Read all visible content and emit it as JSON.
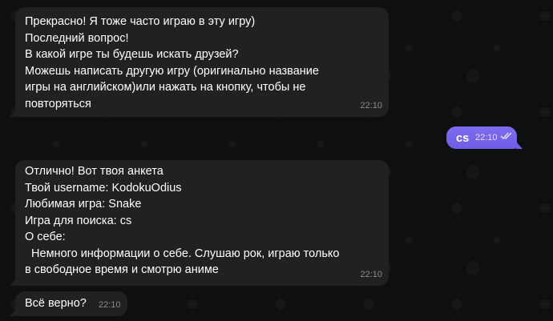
{
  "messages": [
    {
      "lines": [
        "Прекрасно! Я тоже часто играю в эту игру)",
        "Последний вопрос!",
        "В какой игре ты будешь искать друзей?",
        "Можешь написать другую игру (оригинально название",
        "игры на английском)или нажать на кнопку, чтобы не",
        "повторяться"
      ],
      "time": "22:10"
    },
    {
      "text": "cs",
      "time": "22:10",
      "status_icon": "double-check-icon"
    },
    {
      "lines": [
        "Отлично! Вот твоя анкета",
        "Твой username: KodokuOdius",
        "Любимая игра: Snake",
        "Игра для поиска: cs",
        "О себе:",
        "  Немного информации о себе. Слушаю рок, играю только",
        "в свободное время и смотрю аниме"
      ],
      "time": "22:10"
    },
    {
      "text": "Всё верно?",
      "time": "22:10"
    }
  ],
  "colors": {
    "background": "#0f0f0f",
    "incoming_bubble": "#212121",
    "outgoing_bubble": "#7b68ee",
    "time_text": "#8c8c8c"
  }
}
